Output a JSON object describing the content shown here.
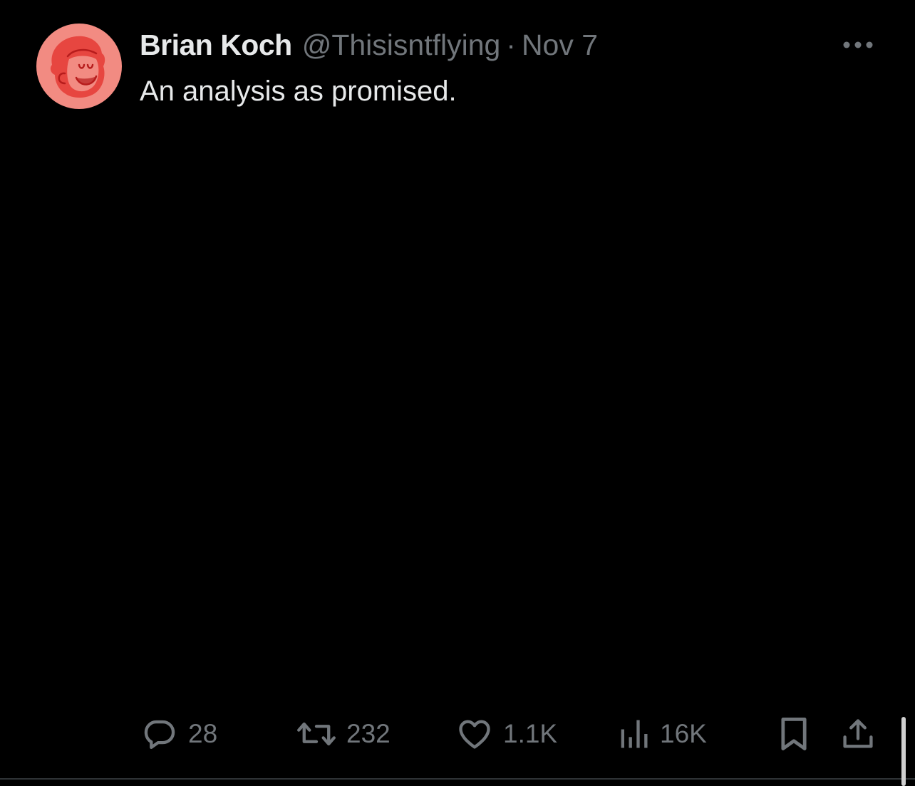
{
  "tweet": {
    "display_name": "Brian Koch",
    "handle": "@Thisisntflying",
    "separator": "·",
    "timestamp": "Nov 7",
    "text": "An analysis as promised."
  },
  "actions": {
    "reply_count": "28",
    "retweet_count": "232",
    "like_count": "1.1K",
    "view_count": "16K"
  },
  "icons": {
    "avatar": "cartoon-face-avatar",
    "more": "more-horizontal-icon",
    "reply": "speech-bubble-icon",
    "retweet": "retweet-arrows-icon",
    "like": "heart-icon",
    "views": "bar-chart-icon",
    "bookmark": "bookmark-icon",
    "share": "share-upload-icon"
  },
  "colors": {
    "background": "#000000",
    "primary_text": "#e7e9ea",
    "secondary_text": "#71767b",
    "avatar_bg": "#f28b82",
    "avatar_ink": "#c62828"
  }
}
